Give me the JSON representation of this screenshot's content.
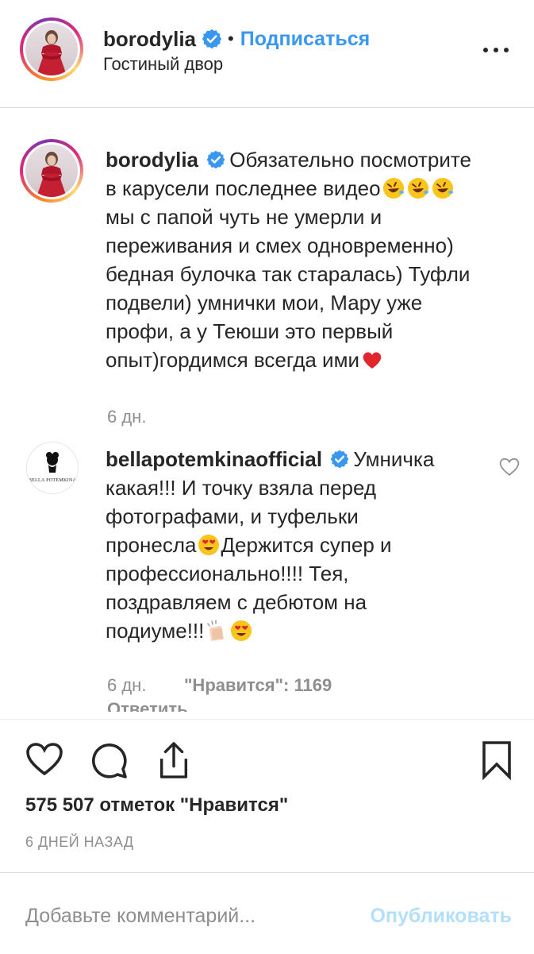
{
  "header": {
    "username": "borodylia",
    "separator": "•",
    "follow_label": "Подписаться",
    "location": "Гостиный двор"
  },
  "caption": {
    "username": "borodylia",
    "lines": [
      "Обязательно посмотрите",
      "в карусели последнее видео",
      "мы с папой чуть не умерли и",
      "переживания и смех одновременно)",
      "бедная булочка так старалась) Туфли",
      "подвели) умнички мои, Мару уже",
      "профи, а у Теюши это первый",
      "опыт)гордимся всегда ими"
    ],
    "time": "6 дн."
  },
  "comment": {
    "username": "bellapotemkinaofficial",
    "avatar_text": "BELLA POTEMKINA",
    "lines": [
      "Умничка",
      "какая!!! И точку взяла перед",
      "фотографами, и туфельки",
      "пронесла",
      "Держится супер и",
      "профессионально!!!! Тея,",
      "поздравляем с дебютом на",
      "подиуме!!!"
    ],
    "time": "6 дн.",
    "likes": "\"Нравится\": 1169",
    "reply_label": "Ответить"
  },
  "post": {
    "likes_total": "575 507 отметок \"Нравится\"",
    "date": "6 ДНЕЙ НАЗАД"
  },
  "comment_box": {
    "placeholder": "Добавьте комментарий...",
    "publish_label": "Опубликовать"
  },
  "colors": {
    "link_blue": "#3897f0",
    "muted": "#8e8e8e",
    "publish_disabled": "#b2dffc",
    "text": "#262626"
  },
  "icons": [
    "verified-badge-icon",
    "more-options-icon",
    "heart-icon",
    "comment-icon",
    "share-icon",
    "bookmark-icon",
    "rofl-emoji",
    "red-heart-emoji",
    "heart-eyes-emoji",
    "clapping-hands-emoji"
  ]
}
